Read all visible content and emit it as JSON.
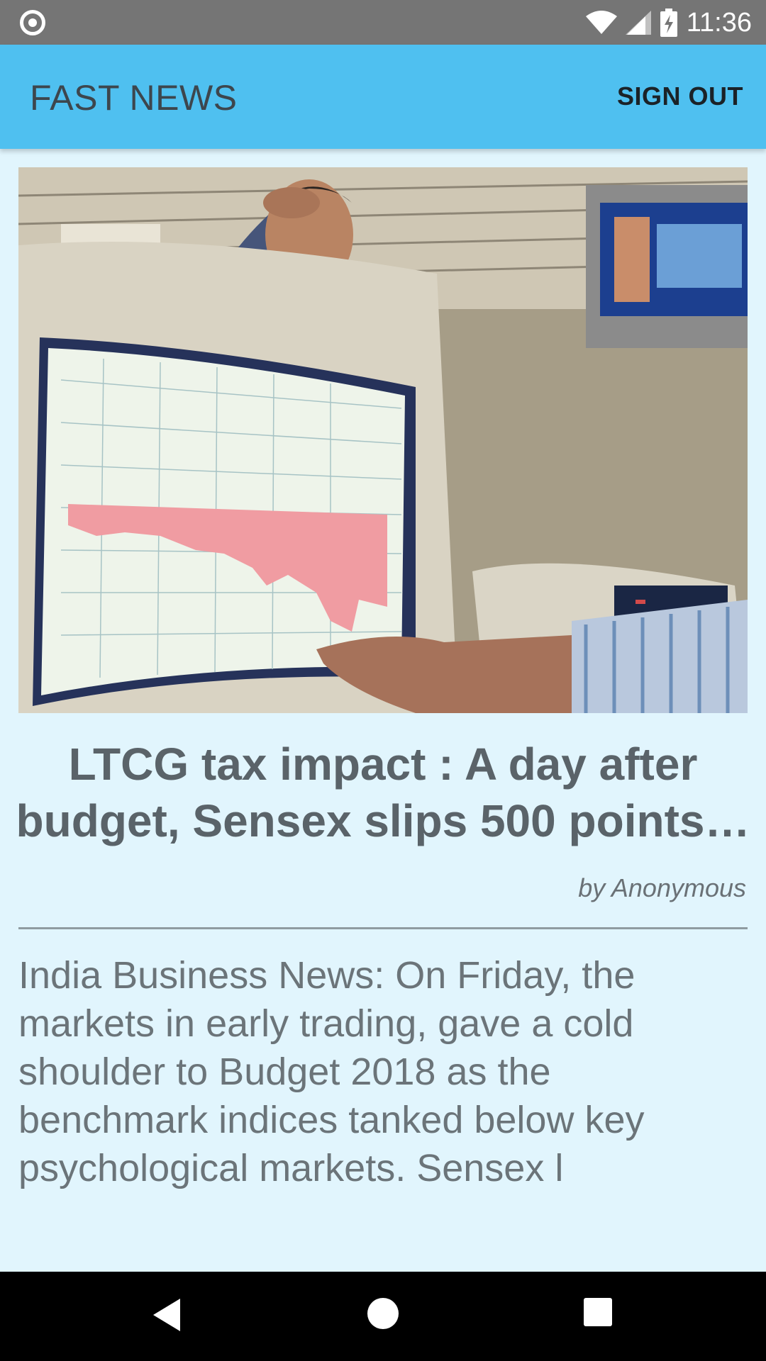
{
  "status_bar": {
    "time": "11:36",
    "icons": [
      "notification-circle-icon",
      "wifi-icon",
      "signal-icon",
      "battery-charging-icon"
    ]
  },
  "app_bar": {
    "title": "FAST NEWS",
    "sign_out_label": "SIGN OUT",
    "color": "#4fc0f0"
  },
  "article": {
    "image_alt": "Trader looking at stock market chart on monitor",
    "headline": "LTCG tax impact : A day after budget, Sensex slips 500 points…",
    "byline": "by Anonymous",
    "summary": "India Business News: On Friday, the markets in early trading, gave a cold shoulder to Budget 2018 as the benchmark indices tanked below key psychological markets. Sensex l"
  },
  "nav_bar": {
    "icons": [
      "back-icon",
      "home-icon",
      "recents-icon"
    ]
  },
  "colors": {
    "background": "#e1f5fd",
    "status_bar": "#757575",
    "text": "#5a6369"
  }
}
